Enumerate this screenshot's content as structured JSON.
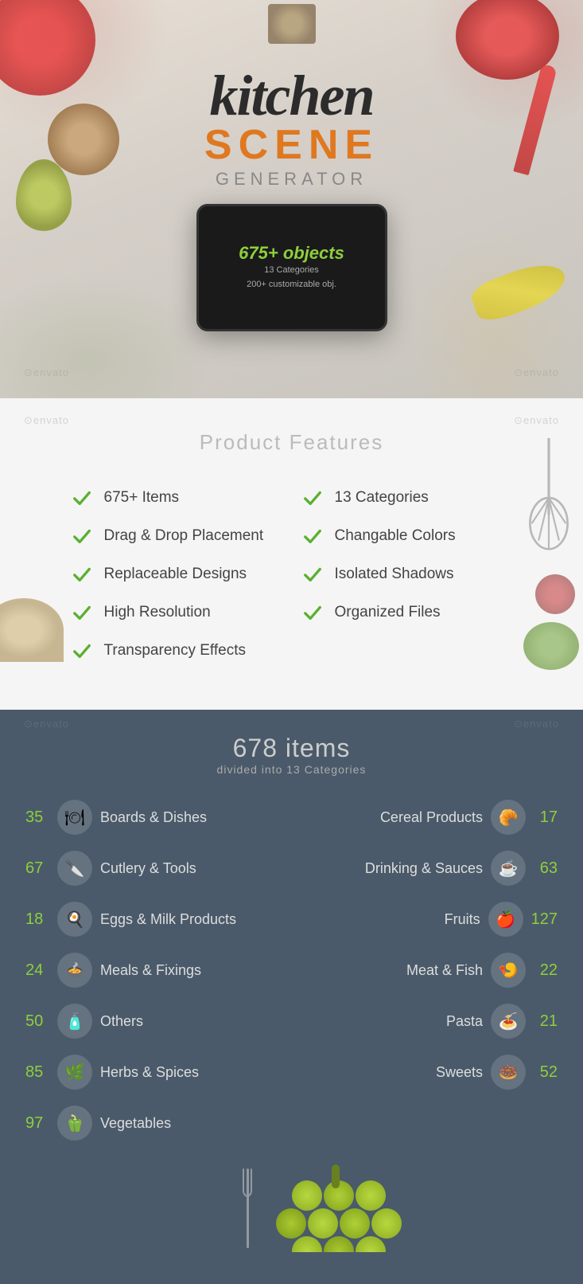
{
  "hero": {
    "title_kitchen": "kitchen",
    "title_scene": "SCENE",
    "title_generator": "GENERATOR",
    "tablet": {
      "objects": "675+ objects",
      "line1": "13 Categories",
      "line2": "200+ customizable obj."
    },
    "envato1": "⊙envato",
    "envato2": "⊙envato"
  },
  "features": {
    "title": "Product Features",
    "envato1": "⊙envato",
    "envato2": "⊙envato",
    "items_left": [
      {
        "label": "675+ Items"
      },
      {
        "label": "Drag & Drop Placement"
      },
      {
        "label": "Replaceable Designs"
      },
      {
        "label": "High Resolution"
      },
      {
        "label": "Transparency Effects"
      }
    ],
    "items_right": [
      {
        "label": "13 Categories"
      },
      {
        "label": "Changable Colors"
      },
      {
        "label": "Isolated Shadows"
      },
      {
        "label": "Organized Files"
      }
    ]
  },
  "categories": {
    "count": "678 items",
    "subtitle": "divided into 13 Categories",
    "envato1": "⊙envato",
    "envato2": "⊙envato",
    "left": [
      {
        "number": "35",
        "name": "Boards & Dishes",
        "icon": "🍽"
      },
      {
        "number": "67",
        "name": "Cutlery & Tools",
        "icon": "🔪"
      },
      {
        "number": "18",
        "name": "Eggs & Milk Products",
        "icon": "🍳"
      },
      {
        "number": "24",
        "name": "Meals & Fixings",
        "icon": "🍲"
      },
      {
        "number": "50",
        "name": "Others",
        "icon": "🧴"
      },
      {
        "number": "85",
        "name": "Herbs & Spices",
        "icon": "🌿"
      },
      {
        "number": "97",
        "name": "Vegetables",
        "icon": "🫑"
      }
    ],
    "right": [
      {
        "number": "17",
        "name": "Cereal Products",
        "icon": "🥐"
      },
      {
        "number": "63",
        "name": "Drinking & Sauces",
        "icon": "☕"
      },
      {
        "number": "127",
        "name": "Fruits",
        "icon": "🍎"
      },
      {
        "number": "22",
        "name": "Meat & Fish",
        "icon": "🍤"
      },
      {
        "number": "21",
        "name": "Pasta",
        "icon": "🍝"
      },
      {
        "number": "52",
        "name": "Sweets",
        "icon": "🍩"
      }
    ]
  }
}
